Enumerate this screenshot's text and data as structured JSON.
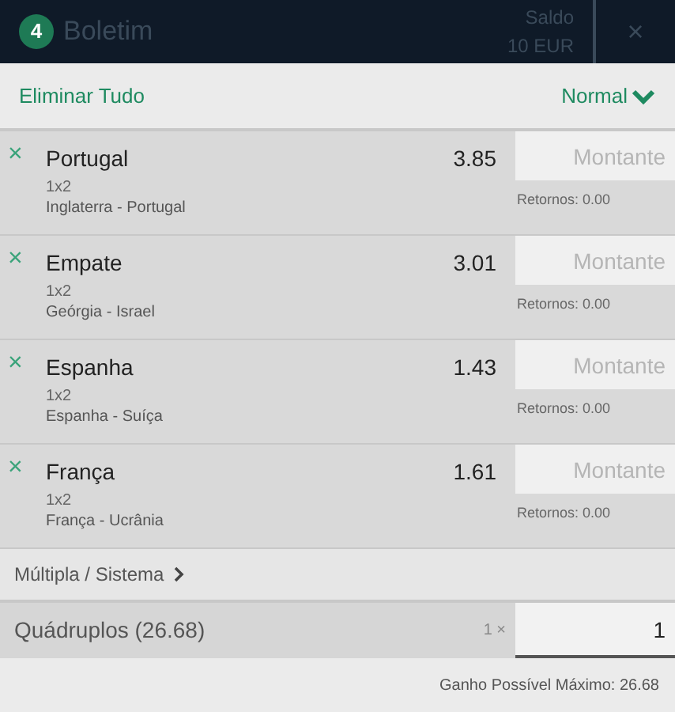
{
  "header": {
    "count": "4",
    "title": "Boletim",
    "balance_label": "Saldo",
    "balance": "10 EUR",
    "close": "×"
  },
  "toolbar": {
    "clear_all": "Eliminar Tudo",
    "mode": "Normal"
  },
  "bets": [
    {
      "remove": "×",
      "selection": "Portugal",
      "market": "1x2",
      "event": "Inglaterra - Portugal",
      "odds": "3.85",
      "stake_placeholder": "Montante",
      "returns": "Retornos: 0.00"
    },
    {
      "remove": "×",
      "selection": "Empate",
      "market": "1x2",
      "event": "Geórgia - Israel",
      "odds": "3.01",
      "stake_placeholder": "Montante",
      "returns": "Retornos: 0.00"
    },
    {
      "remove": "×",
      "selection": "Espanha",
      "market": "1x2",
      "event": "Espanha - Suíça",
      "odds": "1.43",
      "stake_placeholder": "Montante",
      "returns": "Retornos: 0.00"
    },
    {
      "remove": "×",
      "selection": "França",
      "market": "1x2",
      "event": "França - Ucrânia",
      "odds": "1.61",
      "stake_placeholder": "Montante",
      "returns": "Retornos: 0.00"
    }
  ],
  "multiple": {
    "label": "Múltipla / Sistema"
  },
  "combo": {
    "label": "Quádruplos (26.68)",
    "multiplier": "1 ×",
    "stake": "1"
  },
  "footer": {
    "max_win": "Ganho Possível Máximo: 26.68"
  }
}
